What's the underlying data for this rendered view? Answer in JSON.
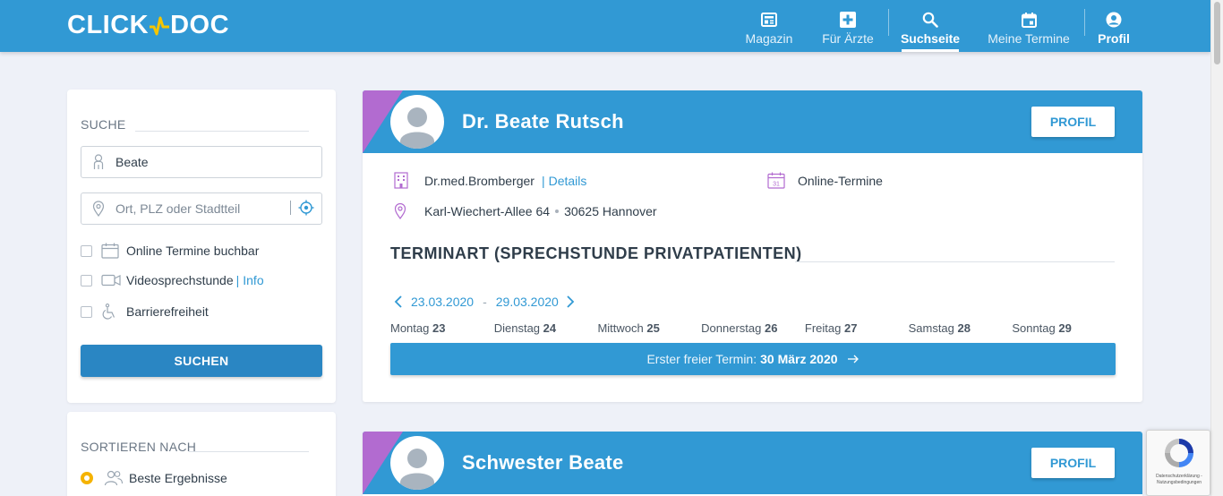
{
  "header": {
    "logo": {
      "left": "CLICK",
      "right": "DOC"
    },
    "nav": [
      {
        "label": "Magazin",
        "icon": "newspaper-icon"
      },
      {
        "label": "Für Ärzte",
        "icon": "medical-cross-icon"
      },
      {
        "label": "Suchseite",
        "icon": "search-icon",
        "active": true
      },
      {
        "label": "Meine Termine",
        "icon": "calendar-icon"
      },
      {
        "label": "Profil",
        "icon": "user-circle-icon"
      }
    ]
  },
  "sidebar": {
    "search": {
      "title": "SUCHE",
      "name_value": "Beate",
      "location_placeholder": "Ort, PLZ oder Stadtteil",
      "filters": [
        {
          "label": "Online Termine buchbar",
          "icon": "calendar-icon",
          "checked": false
        },
        {
          "label": "Videosprechstunde",
          "link": "Info",
          "icon": "video-icon",
          "checked": false
        },
        {
          "label": "Barrierefreiheit",
          "icon": "wheelchair-icon",
          "checked": false
        }
      ],
      "button": "SUCHEN"
    },
    "sort": {
      "title": "SORTIEREN NACH",
      "options": [
        {
          "label": "Beste Ergebnisse",
          "selected": true
        }
      ]
    }
  },
  "results": [
    {
      "name": "Dr. Beate Rutsch",
      "profile_button": "PROFIL",
      "practice": "Dr.med.Bromberger",
      "details_link": "Details",
      "booking": "Online-Termine",
      "street": "Karl-Wiechert-Allee 64",
      "city": "30625 Hannover",
      "termin_title": "TERMINART (SPRECHSTUNDE PRIVATPATIENTEN)",
      "date_from": "23.03.2020",
      "date_sep": "-",
      "date_to": "29.03.2020",
      "days": [
        {
          "name": "Montag",
          "num": "23"
        },
        {
          "name": "Dienstag",
          "num": "24"
        },
        {
          "name": "Mittwoch",
          "num": "25"
        },
        {
          "name": "Donnerstag",
          "num": "26"
        },
        {
          "name": "Freitag",
          "num": "27"
        },
        {
          "name": "Samstag",
          "num": "28"
        },
        {
          "name": "Sonntag",
          "num": "29"
        }
      ],
      "first_free_label": "Erster freier Termin:",
      "first_free_date": "30 März 2020"
    },
    {
      "name": "Schwester Beate",
      "profile_button": "PROFIL"
    }
  ],
  "recaptcha": {
    "text": "Datenschutzerklärung - Nutzungsbedingungen"
  },
  "colors": {
    "primary": "#3199d4",
    "accent_violet": "#b26bd0",
    "radio": "#f5b300",
    "icon_violet": "#b26bd0"
  }
}
